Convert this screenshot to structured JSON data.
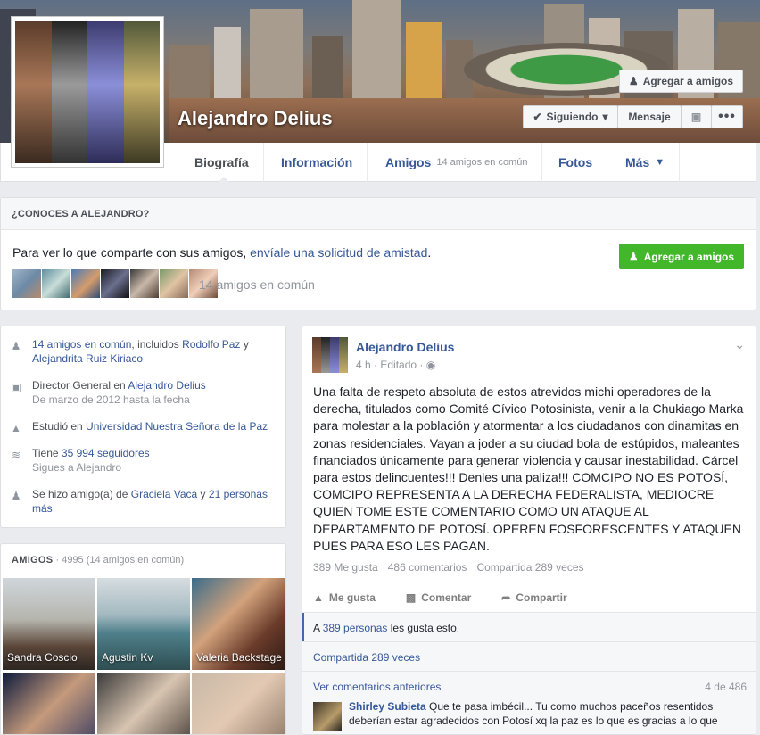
{
  "cover": {
    "name": "Alejandro Delius",
    "add_friend_label": "Agregar a amigos",
    "following_label": "Siguiendo",
    "message_label": "Mensaje"
  },
  "tabs": [
    {
      "label": "Biografía",
      "sub": ""
    },
    {
      "label": "Información",
      "sub": ""
    },
    {
      "label": "Amigos",
      "sub": "14 amigos en común"
    },
    {
      "label": "Fotos",
      "sub": ""
    },
    {
      "label": "Más",
      "sub": ""
    }
  ],
  "know": {
    "heading": "¿CONOCES A ALEJANDRO?",
    "text_prefix": "Para ver lo que comparte con sus amigos, ",
    "text_link": "envíale una solicitud de amistad",
    "text_suffix": ".",
    "add_label": "Agregar a amigos",
    "mutual_count": "14 amigos en común"
  },
  "intro": {
    "mutual": {
      "link": "14 amigos en común",
      "mid": ", incluidos ",
      "a": "Rodolfo Paz",
      "and": " y",
      "b": "Alejandrita Ruiz Kiriaco"
    },
    "work": {
      "prefix": "Director General en ",
      "link": "Alejandro Delius",
      "sub": "De marzo de 2012 hasta la fecha"
    },
    "study": {
      "prefix": "Estudió en ",
      "link": "Universidad Nuestra Señora de la Paz"
    },
    "followers": {
      "prefix": "Tiene ",
      "link": "35 994 seguidores",
      "sub": "Sigues a Alejandro"
    },
    "friendship": {
      "prefix": "Se hizo amigo(a) de ",
      "a": "Graciela Vaca",
      "mid": " y ",
      "b": "21 personas",
      "c": "más"
    }
  },
  "friends": {
    "title": "AMIGOS",
    "count": " · 4995 (14 amigos en común)",
    "tiles": [
      {
        "name": "Sandra Coscio"
      },
      {
        "name": "Agustin Kv"
      },
      {
        "name": "Valeria Backstage"
      },
      {
        "name": ""
      },
      {
        "name": ""
      },
      {
        "name": ""
      }
    ]
  },
  "post": {
    "author": "Alejandro Delius",
    "meta": "4 h · Editado · ",
    "body": "Una falta de respeto absoluta de estos atrevidos michi operadores de la derecha, titulados como Comité Cívico Potosinista, venir a la Chukiago Marka para molestar a la población y atormentar a los ciudadanos con dinamitas en zonas residenciales. Vayan a joder a su ciudad bola de estúpidos, maleantes financiados únicamente para generar violencia y causar inestabilidad. Cárcel para estos delincuentes!!! Denles una paliza!!! COMCIPO NO ES POTOSÍ, COMCIPO REPRESENTA A LA DERECHA FEDERALISTA, MEDIOCRE QUIEN TOME ESTE COMENTARIO COMO UN ATAQUE AL DEPARTAMENTO DE POTOSÍ. OPEREN FOSFORESCENTES Y ATAQUEN PUES PARA ESO LES PAGAN.",
    "likes": "389 Me gusta",
    "comments": "486 comentarios",
    "shares": "Compartida 289 veces",
    "actions": {
      "like": "Me gusta",
      "comment": "Comentar",
      "share": "Compartir"
    },
    "likes_line": {
      "prefix": "A ",
      "link": "389 personas",
      "suffix": " les gusta esto."
    },
    "shared_line": "Compartida 289 veces",
    "previous": "Ver comentarios anteriores",
    "comment_count": "4 de 486",
    "comment": {
      "author": "Shirley Subieta",
      "text": " Que te pasa imbécil... Tu como muchos paceños resentidos deberían estar agradecidos con Potosí xq la paz es lo que es gracias a lo que"
    }
  }
}
